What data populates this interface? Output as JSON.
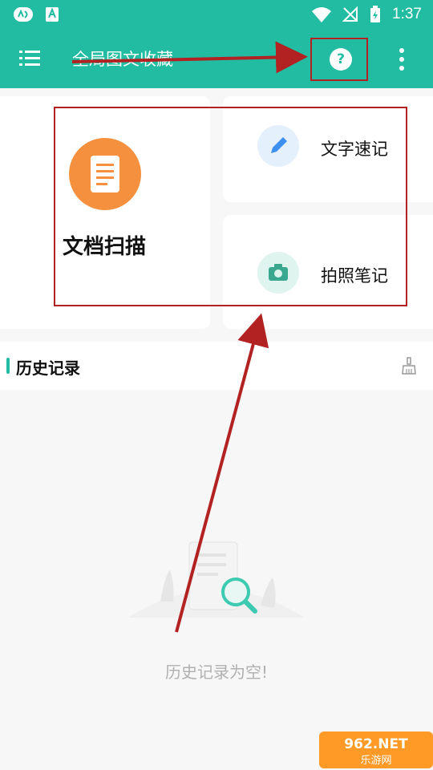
{
  "status_bar": {
    "time": "1:37"
  },
  "toolbar": {
    "title": "全局图文收藏"
  },
  "cards": {
    "document_scan": "文档扫描",
    "quick_note": "文字速记",
    "photo_note": "拍照笔记"
  },
  "history": {
    "title": "历史记录",
    "empty_text": "历史记录为空!"
  },
  "watermark": {
    "text": "962.NET 乐游网"
  },
  "colors": {
    "accent": "#21bca2",
    "doc_orange": "#f5913e",
    "quick_note_blue": "#3d8ff0",
    "annotation_red": "#b22222"
  },
  "icons": {
    "menu": "menu-icon",
    "help": "help-icon",
    "more": "more-vertical-icon",
    "document": "document-icon",
    "pencil": "pencil-icon",
    "camera": "camera-icon",
    "clear": "broom-icon"
  }
}
